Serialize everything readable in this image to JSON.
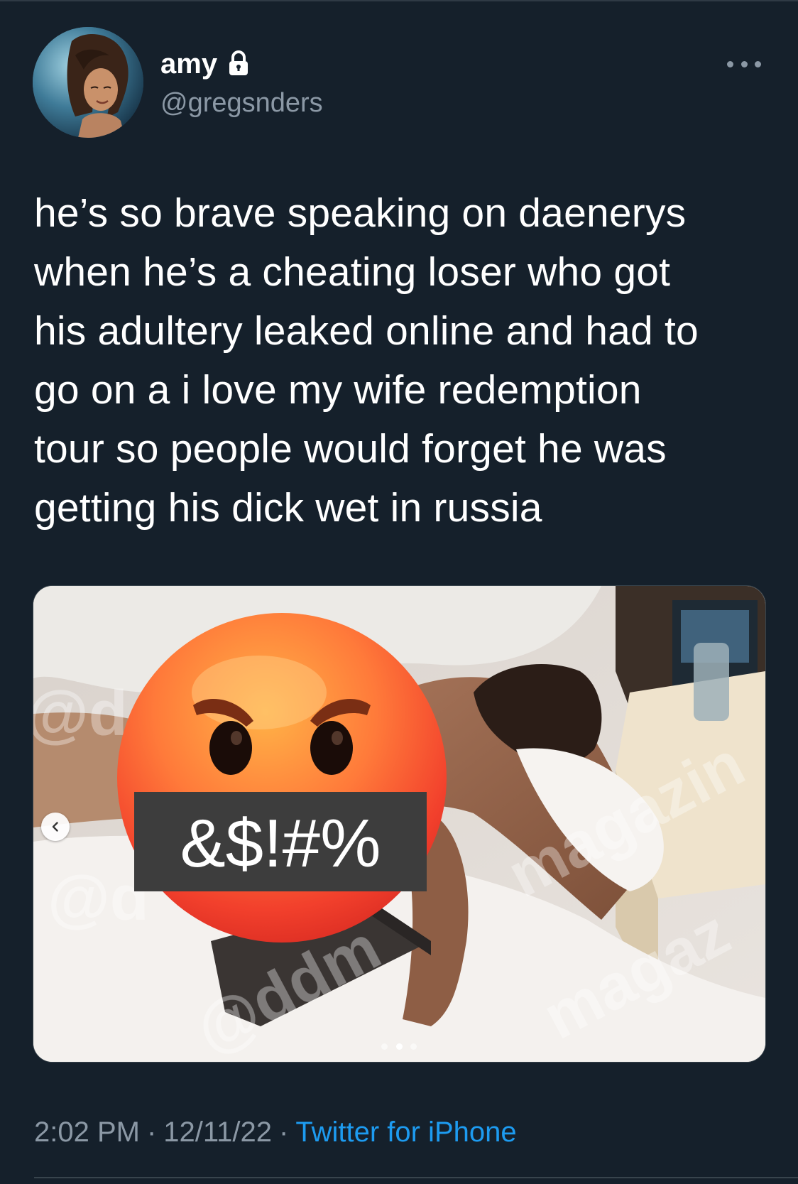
{
  "author": {
    "display_name": "amy",
    "handle": "@gregsnders",
    "protected_icon": "lock-icon",
    "avatar_icon": "profile-photo"
  },
  "menu": {
    "icon": "more-horizontal-icon"
  },
  "tweet": {
    "text": "he’s so brave speaking on daenerys\nwhen he’s a cheating loser who got\nhis adultery leaked online and had to\ngo on a i love my wife redemption\ntour so people would forget he was\ngetting his dick wet in russia"
  },
  "media": {
    "overlay_text": "&$!#%",
    "emoji_icon": "angry-face-emoji",
    "watermarks": [
      "@d",
      "@d",
      "magazin",
      "magaz",
      "@ddm",
      "magaz"
    ],
    "carousel": {
      "prev_icon": "chevron-left-icon",
      "page_count": 3,
      "active_index": 1
    }
  },
  "meta": {
    "time": "2:02 PM",
    "date": "12/11/22",
    "separator": "·",
    "source": "Twitter for iPhone"
  },
  "colors": {
    "background": "#15202b",
    "secondary_text": "#8b98a5",
    "link": "#1d9bf0",
    "divider": "#38444d"
  }
}
